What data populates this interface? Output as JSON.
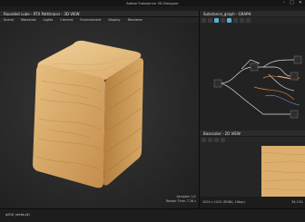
{
  "app": {
    "title": "Adobe Substance 3D Designer"
  },
  "window_controls": {
    "minimize": "–",
    "maximize": "□",
    "close": "✕"
  },
  "view3d": {
    "title": "Rounded cube - RTX Pathtracer - 3D VIEW",
    "menu": [
      "Scene",
      "Materials",
      "Lights",
      "Camera",
      "Environment",
      "Display",
      "Renderer"
    ],
    "stats": {
      "samples": "Samples: 1/1",
      "render_time": "Render Time: 7.26 s"
    }
  },
  "graph": {
    "title": "Substance_graph - GRAPH"
  },
  "view2d": {
    "title": "Basecolor - 2D VIEW",
    "info": "1024 x 1024 (RGBA, 16bpc)",
    "zoom": "36.13%"
  },
  "status": {
    "material": "all00 (default)"
  },
  "colors": {
    "accent": "#5ab0d6",
    "wood_light": "#e3b978",
    "wood_dark": "#c58f4e"
  }
}
